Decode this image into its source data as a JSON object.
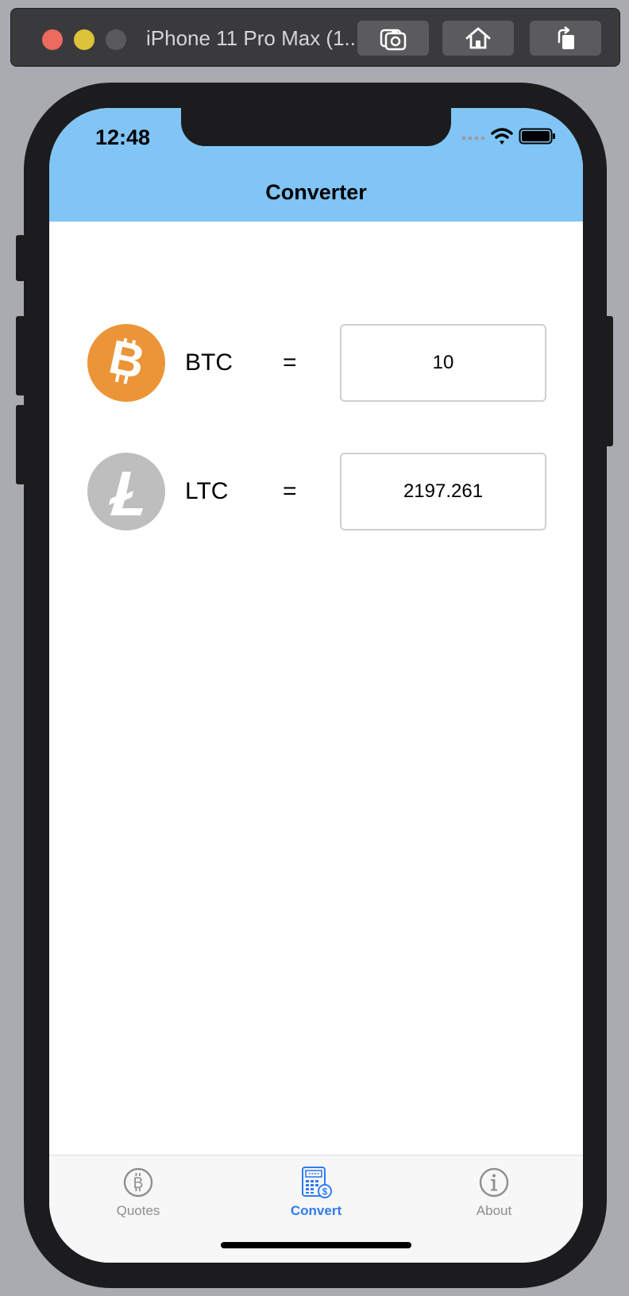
{
  "simulator": {
    "title": "iPhone 11 Pro Max (1..."
  },
  "status_bar": {
    "time": "12:48"
  },
  "nav": {
    "title": "Converter"
  },
  "converter": {
    "rows": [
      {
        "code": "BTC",
        "equals": "=",
        "amount": "10",
        "icon": "bitcoin-icon",
        "color": "#ec9538"
      },
      {
        "code": "LTC",
        "equals": "=",
        "amount": "2197.261",
        "icon": "litecoin-icon",
        "color": "#bebebe"
      }
    ]
  },
  "tabs": [
    {
      "label": "Quotes",
      "icon": "bitcoin-outline-icon",
      "active": false
    },
    {
      "label": "Convert",
      "icon": "calculator-dollar-icon",
      "active": true
    },
    {
      "label": "About",
      "icon": "info-icon",
      "active": false
    }
  ],
  "colors": {
    "nav_bar": "#80c5f5",
    "active_tab": "#2f7bf5",
    "inactive_tab": "#8e8e93"
  }
}
